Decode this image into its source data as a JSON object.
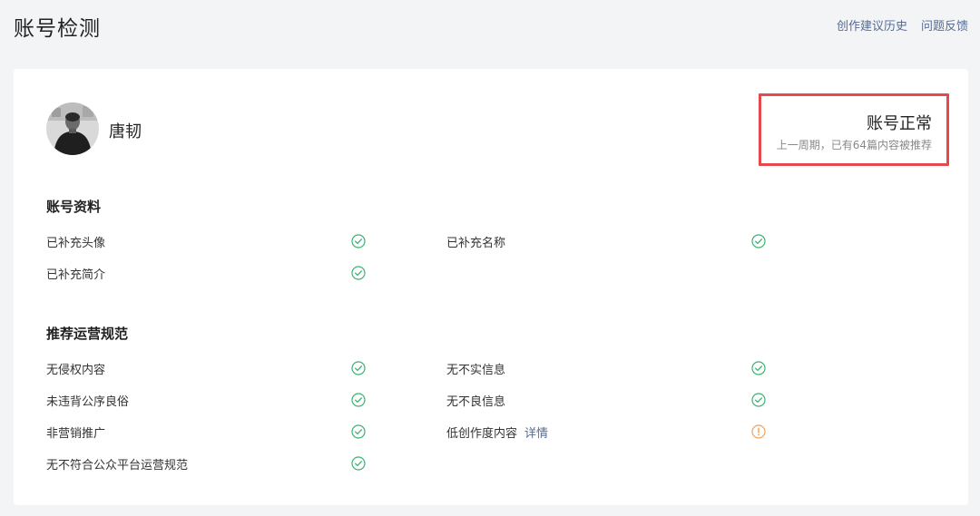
{
  "header": {
    "title": "账号检测",
    "links": [
      "创作建议历史",
      "问题反馈"
    ]
  },
  "profile": {
    "name": "唐韧",
    "avatar_icon": "avatar-photo"
  },
  "status": {
    "title": "账号正常",
    "description": "上一周期，已有64篇内容被推荐",
    "highlight_color": "#e5484d"
  },
  "sections": {
    "account_info": {
      "title": "账号资料",
      "items": [
        {
          "label": "已补充头像",
          "state": "ok"
        },
        {
          "label": "已补充名称",
          "state": "ok"
        },
        {
          "label": "已补充简介",
          "state": "ok"
        }
      ]
    },
    "recommend_rules": {
      "title": "推荐运营规范",
      "items": [
        {
          "label": "无侵权内容",
          "state": "ok"
        },
        {
          "label": "无不实信息",
          "state": "ok"
        },
        {
          "label": "未违背公序良俗",
          "state": "ok"
        },
        {
          "label": "无不良信息",
          "state": "ok"
        },
        {
          "label": "非营销推广",
          "state": "ok"
        },
        {
          "label": "低创作度内容",
          "state": "warning",
          "detail_link": "详情"
        },
        {
          "label": "无不符合公众平台运营规范",
          "state": "ok"
        }
      ]
    }
  },
  "colors": {
    "ok": "#3cb371",
    "warning": "#f0a05a",
    "link": "#576b95"
  }
}
